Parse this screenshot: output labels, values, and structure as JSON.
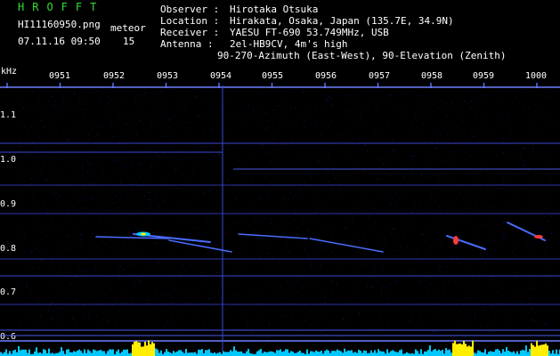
{
  "header": {
    "brand": "HROFFT",
    "filename": "HI11160950.png",
    "datetime": "07.11.16 09:50",
    "count_label": "meteor",
    "count_value": "15",
    "observer_label": "Observer :",
    "observer_value": "Hirotaka Otsuka",
    "location_label": "Location :",
    "location_value": "Hirakata, Osaka, Japan (135.7E, 34.9N)",
    "receiver_label": "Receiver :",
    "receiver_value": "YAESU FT-690 53.749MHz, USB",
    "antenna_label": "Antenna :",
    "antenna_value": "2el-HB9CV, 4m's high",
    "antenna_value_2": "90-270-Azimuth (East-West), 90-Elevation (Zenith)"
  },
  "axis": {
    "unit": "kHz",
    "time_labels": [
      "0951",
      "0952",
      "0953",
      "0954",
      "0955",
      "0956",
      "0957",
      "0958",
      "0959",
      "1000"
    ],
    "freq_labels": [
      "1.1",
      "1.0",
      "0.9",
      "0.8",
      "0.7",
      "0.6"
    ]
  },
  "colors": {
    "background": "#000000",
    "noise": "#1a1a8c",
    "trace": "#4a6cff",
    "echo_core": "#ff3b3b",
    "level_cyan": "#00c8ff",
    "level_yellow": "#ffee00",
    "text_white": "#ffffff",
    "text_green": "#33dd33"
  }
}
